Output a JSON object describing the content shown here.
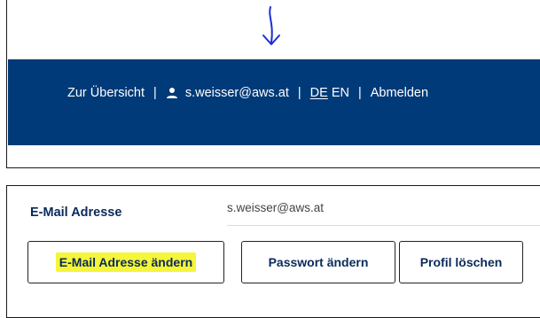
{
  "header": {
    "nav": {
      "overview_label": "Zur Übersicht",
      "separator": "|",
      "user_email": "s.weisser@aws.at",
      "lang_de": "DE",
      "lang_en": "EN",
      "logout_label": "Abmelden"
    },
    "colors": {
      "nav_background": "#003a78",
      "nav_text": "#ffffff"
    },
    "icons": {
      "annotation": "arrow-down-icon",
      "user": "user-icon"
    }
  },
  "profile": {
    "email_label": "E-Mail Adresse",
    "email_value": "s.weisser@aws.at",
    "buttons": {
      "change_email": "E-Mail Adresse ändern",
      "change_password": "Passwort ändern",
      "delete_profile": "Profil löschen"
    },
    "colors": {
      "label_text": "#0a2a5a",
      "highlight": "#f5f53a"
    }
  }
}
